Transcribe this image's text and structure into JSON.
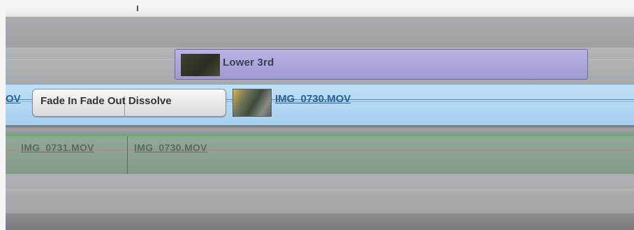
{
  "timeline": {
    "title_track": {
      "clip": {
        "label": "Lower 3rd",
        "thumbnail_icon": "title-thumbnail"
      }
    },
    "video_track": {
      "left_clip_label": "OV",
      "transition": {
        "label": "Fade In Fade Out Dissolve"
      },
      "clip": {
        "label": "IMG_0730.MOV",
        "thumbnail_icon": "video-thumbnail"
      }
    },
    "audio_track": {
      "clips": [
        {
          "label": "IMG_0731.MOV"
        },
        {
          "label": "IMG_0730.MOV"
        }
      ]
    }
  },
  "colors": {
    "title_clip": "#a9a5db",
    "video_track": "#b3d8f3",
    "audio_track": "#8ea292",
    "clip_label": "#2b5f98"
  }
}
